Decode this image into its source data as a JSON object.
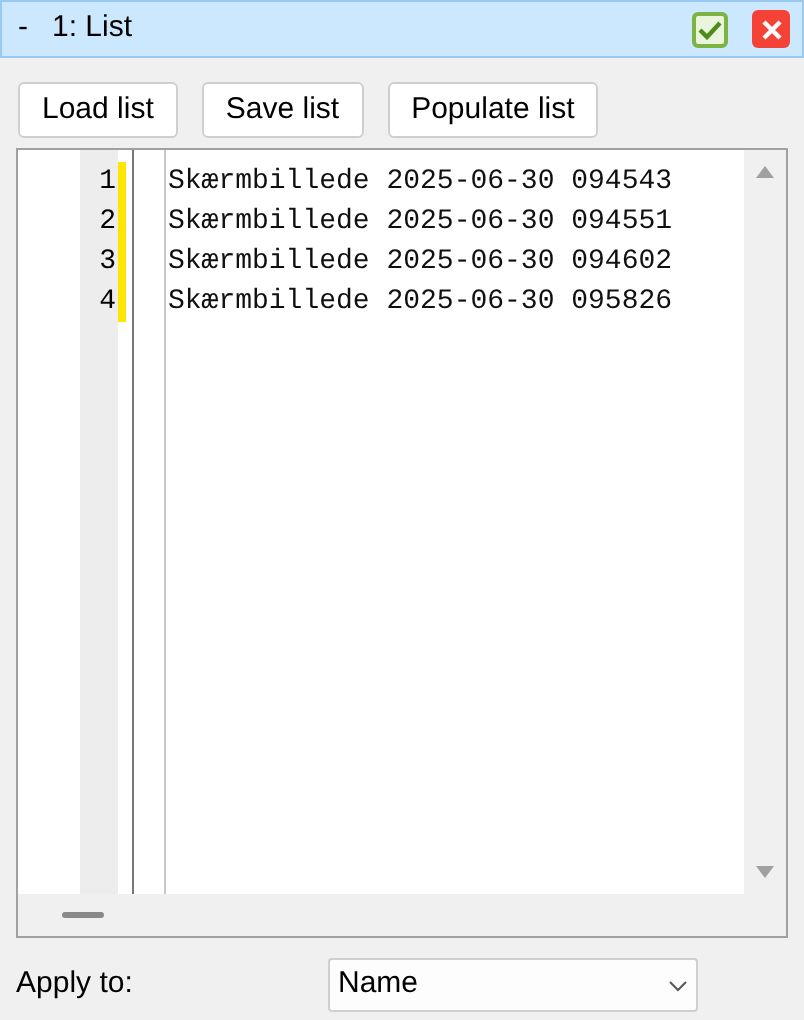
{
  "window": {
    "menu_glyph": "-",
    "title": "1: List"
  },
  "buttons": [
    "Load list",
    "Save list",
    "Populate list"
  ],
  "editor": {
    "lines": [
      {
        "number": "1",
        "text": "Skærmbillede 2025-06-30 094543",
        "modified": true
      },
      {
        "number": "2",
        "text": "Skærmbillede 2025-06-30 094551",
        "modified": true
      },
      {
        "number": "3",
        "text": "Skærmbillede 2025-06-30 094602",
        "modified": true
      },
      {
        "number": "4",
        "text": "Skærmbillede 2025-06-30 095826",
        "modified": true
      }
    ]
  },
  "apply_to": {
    "label": "Apply to:",
    "value": "Name"
  }
}
